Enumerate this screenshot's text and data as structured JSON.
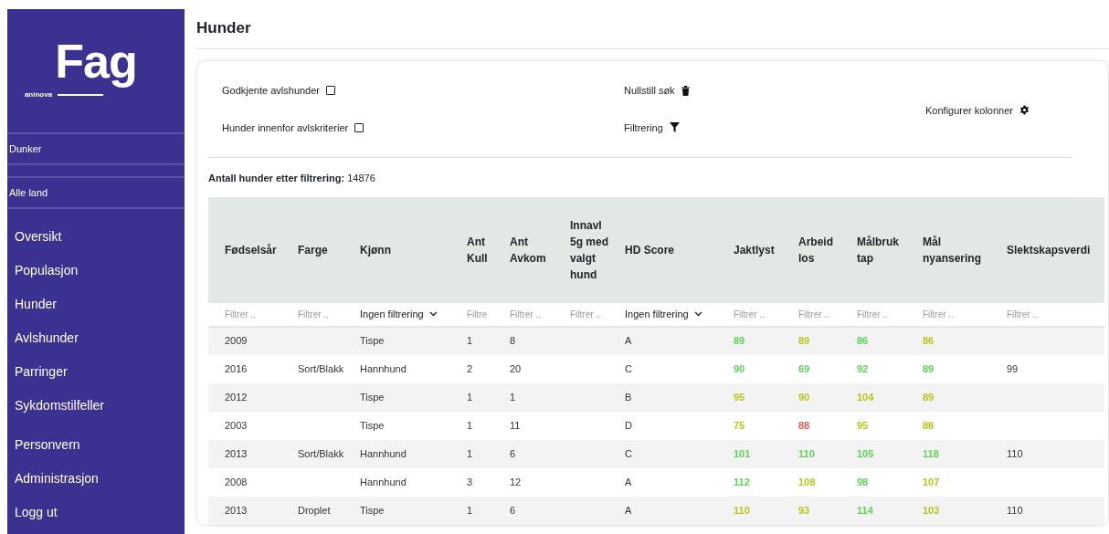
{
  "sidebar": {
    "logo": {
      "title": "Fag",
      "subtitle": "aninova"
    },
    "breed": "Dunker",
    "country": "Alle land",
    "menu": [
      "Oversikt",
      "Populasjon",
      "Hunder",
      "Avlshunder",
      "Parringer",
      "Sykdomstilfeller"
    ],
    "menu_bottom": [
      "Personvern",
      "Administrasjon",
      "Logg ut"
    ]
  },
  "page_title": "Hunder",
  "filters": {
    "checkboxes": [
      {
        "label": "Godkjente avlshunder",
        "checked": false
      },
      {
        "label": "Hunder innenfor avlskriterier",
        "checked": false
      }
    ],
    "reset": "Nullstill søk",
    "filtering": "Filtrering",
    "configure": "Konfigurer kolonner"
  },
  "count": {
    "label": "Antall hunder etter filtrering:",
    "value": "14876"
  },
  "table": {
    "columns": [
      {
        "label": "Fødselsår",
        "filter": {
          "kind": "text",
          "placeholder": "Filtrer .."
        }
      },
      {
        "label": "Farge",
        "filter": {
          "kind": "text",
          "placeholder": "Filtrer .."
        }
      },
      {
        "label": "Kjønn",
        "filter": {
          "kind": "select",
          "value": "Ingen filtrering"
        }
      },
      {
        "label": "Ant Kull",
        "filter": {
          "kind": "text",
          "placeholder": "Filtre"
        }
      },
      {
        "label": "Ant Avkom",
        "filter": {
          "kind": "text",
          "placeholder": "Filtrer .."
        }
      },
      {
        "label": "Innavl 5g med valgt hund",
        "filter": {
          "kind": "text",
          "placeholder": "Filtrer .."
        }
      },
      {
        "label": "HD Score",
        "filter": {
          "kind": "select",
          "value": "Ingen filtrering"
        }
      },
      {
        "label": "Jaktlyst",
        "filter": {
          "kind": "text",
          "placeholder": "Filtrer .."
        }
      },
      {
        "label": "Arbeid los",
        "filter": {
          "kind": "text",
          "placeholder": "Filtrer .."
        }
      },
      {
        "label": "Målbruk tap",
        "filter": {
          "kind": "text",
          "placeholder": "Filtrer .."
        }
      },
      {
        "label": "Mål nyansering",
        "filter": {
          "kind": "text",
          "placeholder": "Filtrer .."
        }
      },
      {
        "label": "Slektskapsverdi",
        "filter": {
          "kind": "text",
          "placeholder": "Filtrer .."
        }
      }
    ],
    "rows": [
      {
        "cells": [
          "2009",
          "",
          "Tispe",
          "1",
          "8",
          "",
          "A",
          {
            "value": "89",
            "color": "#5fd35a"
          },
          {
            "value": "89",
            "color": "#bcc41c"
          },
          {
            "value": "86",
            "color": "#5fd35a"
          },
          {
            "value": "86",
            "color": "#bcc41c"
          },
          ""
        ]
      },
      {
        "cells": [
          "2016",
          "Sort/Blakk",
          "Hannhund",
          "2",
          "20",
          "",
          "C",
          {
            "value": "90",
            "color": "#5fd35a"
          },
          {
            "value": "69",
            "color": "#5fd35a"
          },
          {
            "value": "92",
            "color": "#5fd35a"
          },
          {
            "value": "89",
            "color": "#5fd35a"
          },
          "99"
        ]
      },
      {
        "cells": [
          "2012",
          "",
          "Tispe",
          "1",
          "1",
          "",
          "B",
          {
            "value": "95",
            "color": "#bcc41c"
          },
          {
            "value": "90",
            "color": "#bcc41c"
          },
          {
            "value": "104",
            "color": "#bcc41c"
          },
          {
            "value": "89",
            "color": "#bcc41c"
          },
          ""
        ]
      },
      {
        "cells": [
          "2003",
          "",
          "Tispe",
          "1",
          "11",
          "",
          "D",
          {
            "value": "75",
            "color": "#bcc41c"
          },
          {
            "value": "88",
            "color": "#ec5a5a"
          },
          {
            "value": "95",
            "color": "#bcc41c"
          },
          {
            "value": "88",
            "color": "#bcc41c"
          },
          ""
        ]
      },
      {
        "cells": [
          "2013",
          "Sort/Blakk",
          "Hannhund",
          "1",
          "6",
          "",
          "C",
          {
            "value": "101",
            "color": "#5fd35a"
          },
          {
            "value": "110",
            "color": "#5fd35a"
          },
          {
            "value": "105",
            "color": "#5fd35a"
          },
          {
            "value": "118",
            "color": "#5fd35a"
          },
          "110"
        ]
      },
      {
        "cells": [
          "2008",
          "",
          "Hannhund",
          "3",
          "12",
          "",
          "A",
          {
            "value": "112",
            "color": "#5fd35a"
          },
          {
            "value": "108",
            "color": "#bcc41c"
          },
          {
            "value": "98",
            "color": "#5fd35a"
          },
          {
            "value": "107",
            "color": "#bcc41c"
          },
          ""
        ]
      },
      {
        "cells": [
          "2013",
          "Droplet",
          "Tispe",
          "1",
          "6",
          "",
          "A",
          {
            "value": "110",
            "color": "#bcc41c"
          },
          {
            "value": "93",
            "color": "#bcc41c"
          },
          {
            "value": "114",
            "color": "#5fd35a"
          },
          {
            "value": "103",
            "color": "#bcc41c"
          },
          "110"
        ]
      }
    ]
  }
}
